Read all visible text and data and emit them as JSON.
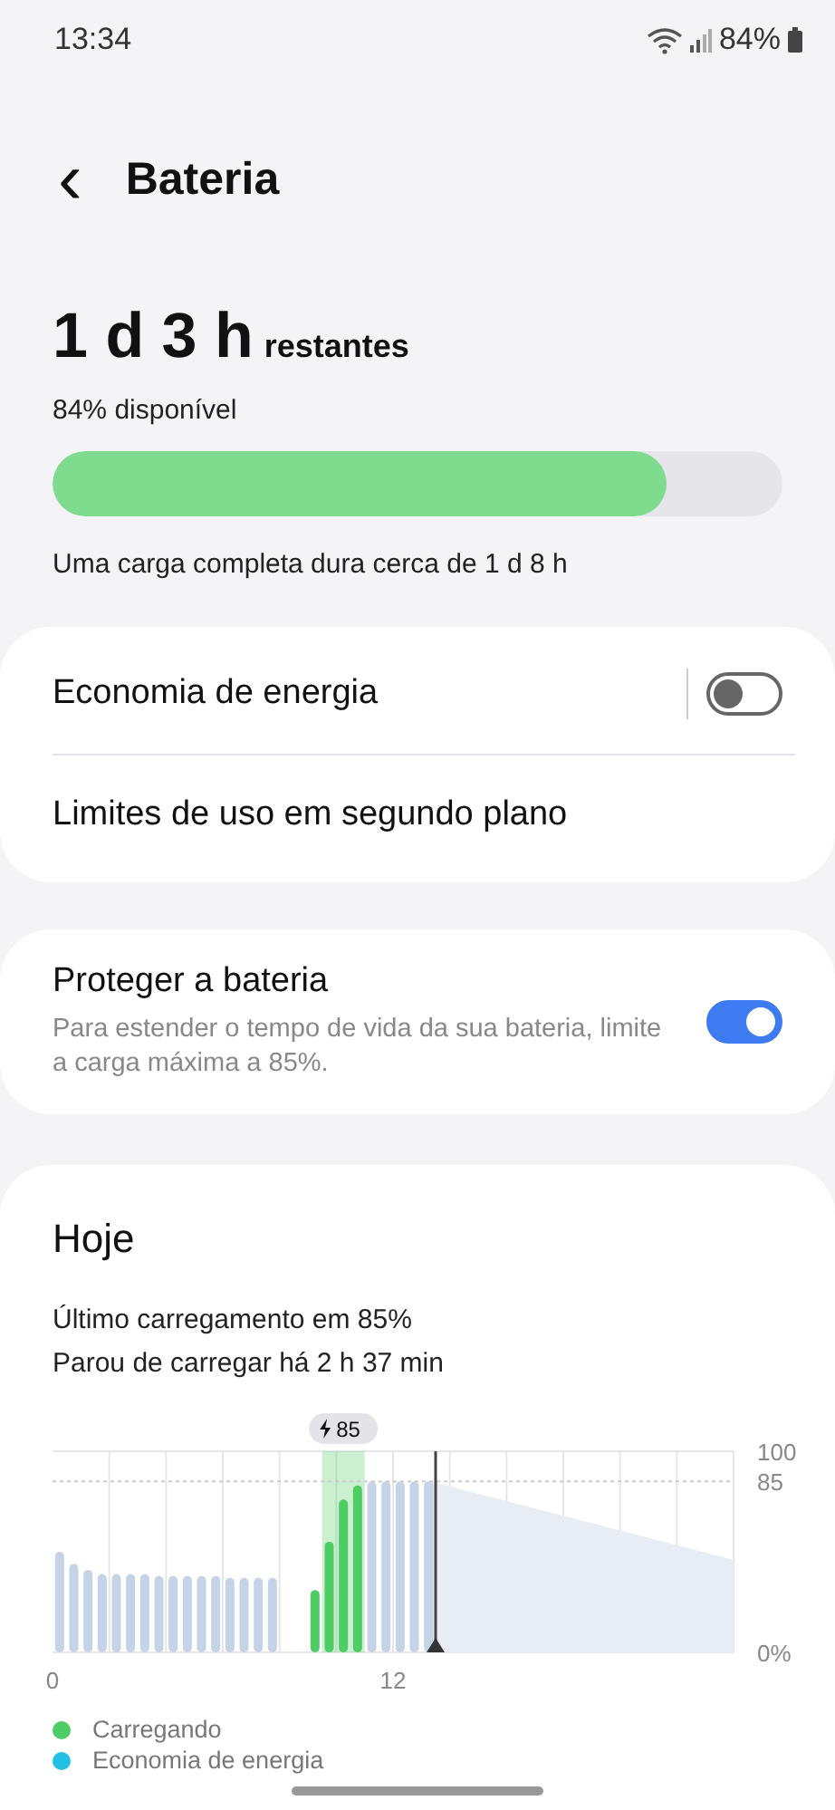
{
  "status_bar": {
    "time": "13:34",
    "battery": "84%"
  },
  "header": {
    "back": "‹",
    "title": "Bateria"
  },
  "battery": {
    "remaining": "1 d 3 h",
    "remaining_suffix": "restantes",
    "available": "84% disponível",
    "level": 0.84,
    "full_charge": "Uma carga completa dura cerca de 1 d 8 h"
  },
  "settings_card": {
    "items": [
      {
        "kind": "toggle",
        "label": "Economia de energia",
        "on": false
      },
      {
        "kind": "link",
        "label": "Limites de uso em segundo plano"
      }
    ]
  },
  "protect_card": {
    "label": "Proteger a bateria",
    "description": "Para estender o tempo de vida da sua bateria, limite a carga máxima a 85%.",
    "on": true
  },
  "today": {
    "title": "Hoje",
    "last_charge": "Último carregamento em 85%",
    "stopped": "Parou de carregar há 2 h 37 min",
    "chart_data": {
      "type": "bar",
      "x": [
        0.25,
        0.75,
        1.25,
        1.75,
        2.25,
        2.75,
        3.25,
        3.75,
        4.25,
        4.75,
        5.25,
        5.75,
        6.25,
        6.75,
        7.25,
        7.75,
        9.25,
        9.75,
        10.25,
        10.75,
        11.25,
        11.75,
        12.25,
        12.75,
        13.25
      ],
      "series": [
        {
          "color": "#c5d3e6",
          "values": [
            50,
            44,
            41,
            39,
            39,
            39,
            39,
            38,
            38,
            38,
            38,
            38,
            37,
            37,
            37,
            37,
            null,
            null,
            null,
            null,
            85,
            85,
            85,
            85,
            85
          ]
        },
        {
          "name": "Carregando",
          "color": "#4fcc63",
          "values": [
            null,
            null,
            null,
            null,
            null,
            null,
            null,
            null,
            null,
            null,
            null,
            null,
            null,
            null,
            null,
            null,
            31,
            55,
            76,
            83,
            null,
            null,
            null,
            null,
            null
          ]
        },
        {
          "name": "Economia de energia",
          "color": "#22c1e4",
          "values": [
            null,
            null,
            null,
            null,
            null,
            null,
            null,
            null,
            null,
            null,
            null,
            null,
            null,
            null,
            null,
            null,
            null,
            null,
            null,
            null,
            null,
            null,
            null,
            null,
            null
          ]
        }
      ],
      "xlim": [
        0,
        24
      ],
      "ylim": [
        0,
        100
      ],
      "xticks": [
        0,
        12
      ],
      "yticks": [
        {
          "value": 0,
          "label": "0%"
        },
        85,
        100
      ],
      "ref_lines": [
        {
          "axis": "y",
          "value": 85
        },
        {
          "axis": "x",
          "value": 13.5
        }
      ],
      "bands": [
        {
          "axis": "x",
          "from": 9.5,
          "to": 11
        }
      ],
      "annotations": [
        "85"
      ]
    }
  }
}
